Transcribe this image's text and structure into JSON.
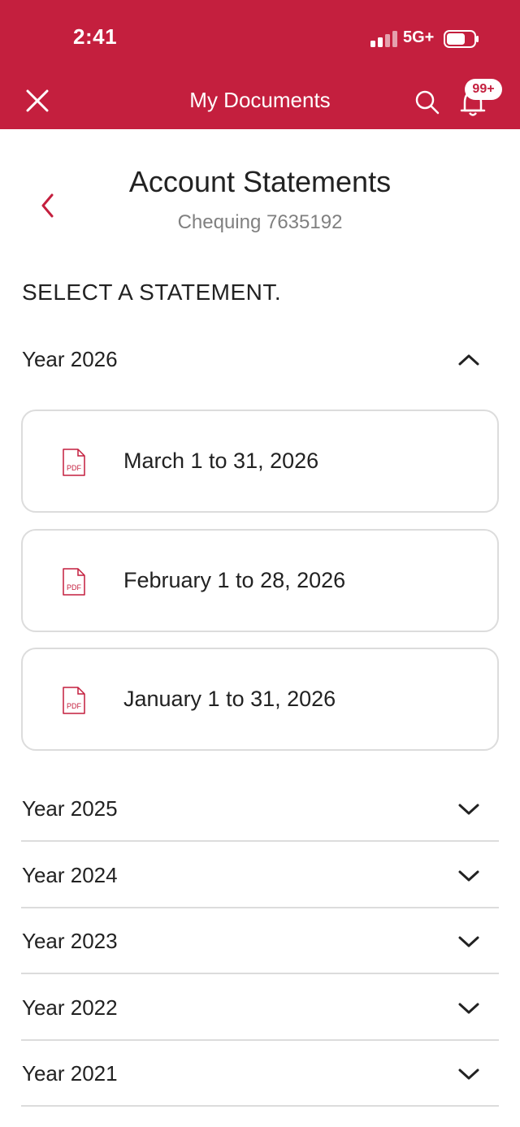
{
  "status_bar": {
    "time": "2:41",
    "network": "5G+",
    "signal_icon": "cellular-signal-icon",
    "battery_icon": "battery-icon"
  },
  "nav": {
    "title": "My Documents",
    "close_icon": "close-icon",
    "search_icon": "search-icon",
    "bell_icon": "bell-icon",
    "notification_badge": "99+"
  },
  "header": {
    "back_icon": "chevron-left-icon",
    "title": "Account Statements",
    "subtitle": "Chequing 7635192"
  },
  "section_label": "SELECT A STATEMENT.",
  "years": [
    {
      "label": "Year 2026",
      "expanded": true,
      "statements": [
        {
          "label": "March 1 to 31, 2026",
          "icon": "pdf-icon",
          "icon_text": "PDF"
        },
        {
          "label": "February 1 to 28, 2026",
          "icon": "pdf-icon",
          "icon_text": "PDF"
        },
        {
          "label": "January 1 to 31, 2026",
          "icon": "pdf-icon",
          "icon_text": "PDF"
        }
      ]
    },
    {
      "label": "Year 2025",
      "expanded": false
    },
    {
      "label": "Year 2024",
      "expanded": false
    },
    {
      "label": "Year 2023",
      "expanded": false
    },
    {
      "label": "Year 2022",
      "expanded": false
    },
    {
      "label": "Year 2021",
      "expanded": false
    }
  ],
  "colors": {
    "brand_red": "#c41f3e",
    "text": "#222222",
    "muted_text": "#808080",
    "border": "#dcdcdc"
  }
}
